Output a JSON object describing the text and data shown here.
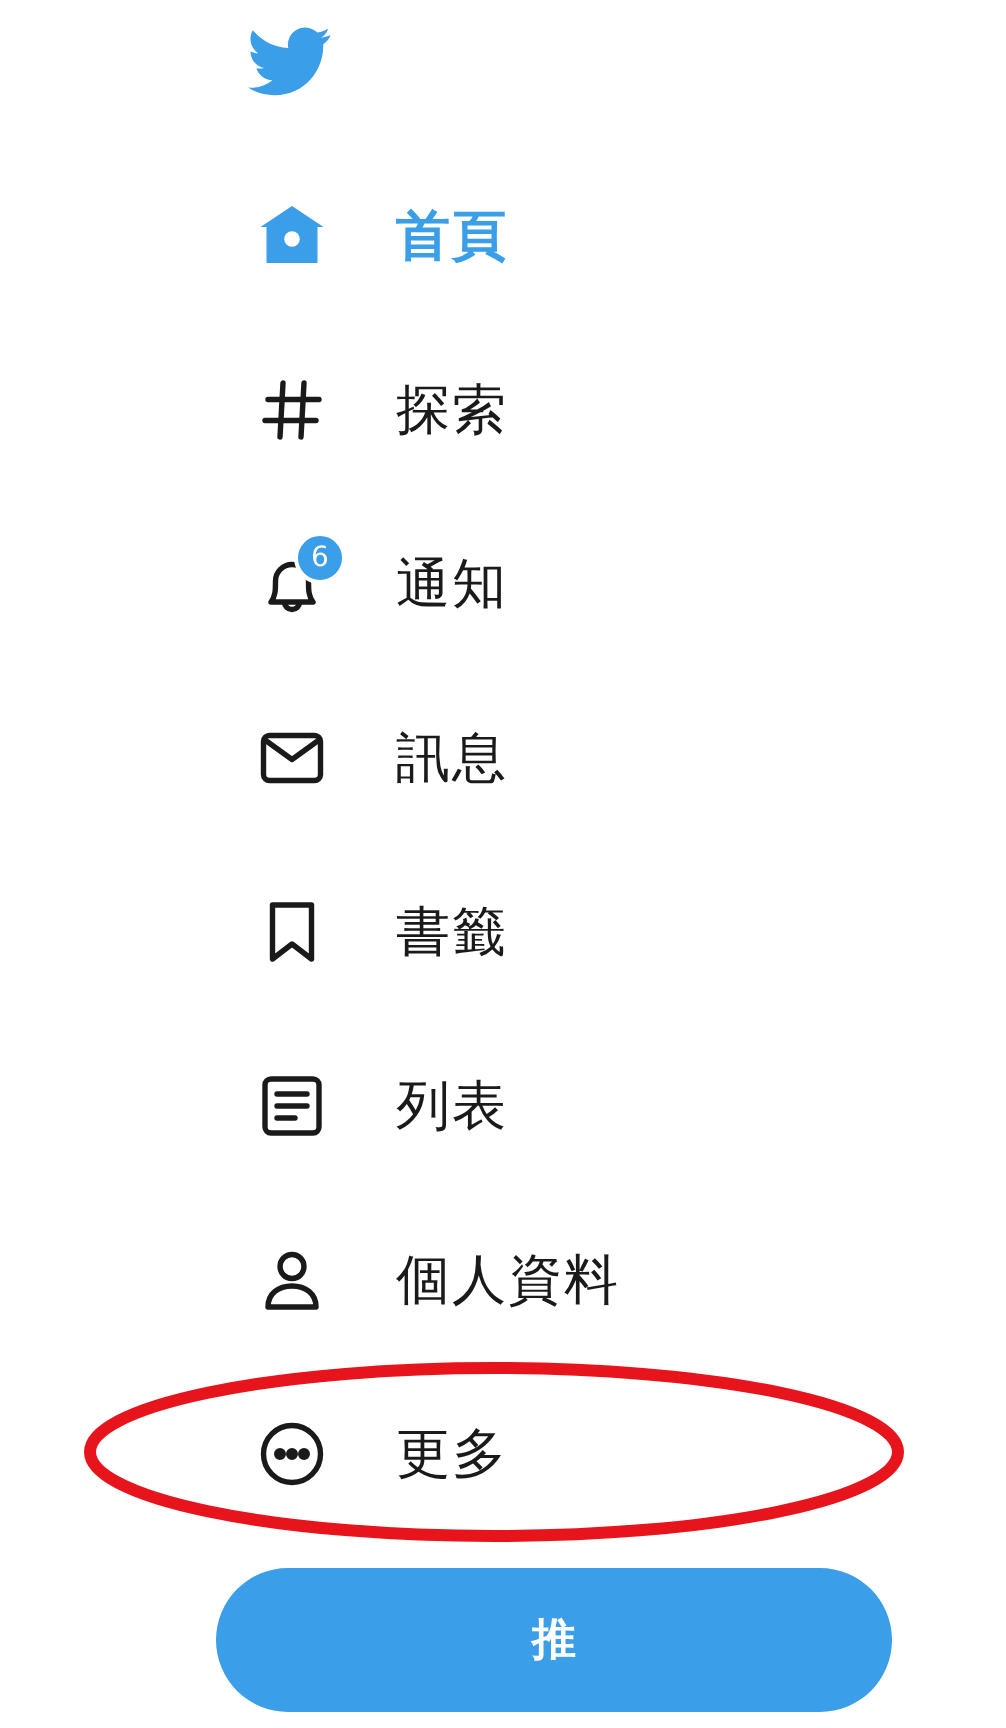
{
  "nav": [
    {
      "kind": "home",
      "label": "首頁",
      "selected": true
    },
    {
      "kind": "hash",
      "label": "探索",
      "selected": false
    },
    {
      "kind": "bell",
      "label": "通知",
      "selected": false,
      "badge": "6"
    },
    {
      "kind": "mail",
      "label": "訊息",
      "selected": false
    },
    {
      "kind": "bookmark",
      "label": "書籤",
      "selected": false
    },
    {
      "kind": "list",
      "label": "列表",
      "selected": false
    },
    {
      "kind": "person",
      "label": "個人資料",
      "selected": false
    },
    {
      "kind": "more",
      "label": "更多",
      "selected": false,
      "circled": true
    }
  ],
  "tweet_button": {
    "label": "推"
  }
}
